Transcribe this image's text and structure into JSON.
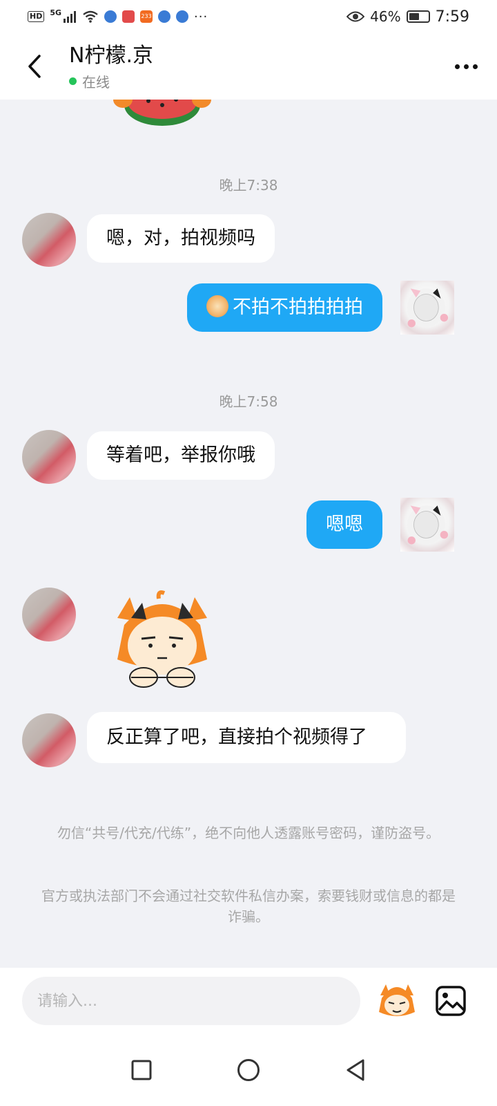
{
  "status_bar": {
    "hd": "HD",
    "network": "5G",
    "app_badge": "233",
    "overflow": "···",
    "battery": "46%",
    "time": "7:59"
  },
  "header": {
    "title": "N柠檬.京",
    "status": "在线"
  },
  "messages": [
    {
      "type": "timestamp",
      "text": "晚上7:38"
    },
    {
      "type": "incoming",
      "text": "嗯，对，拍视频吗"
    },
    {
      "type": "outgoing",
      "text": "不拍不拍拍拍拍"
    },
    {
      "type": "timestamp",
      "text": "晚上7:58"
    },
    {
      "type": "incoming",
      "text": "等着吧，举报你哦"
    },
    {
      "type": "outgoing",
      "text": "嗯嗯"
    },
    {
      "type": "incoming_sticker"
    },
    {
      "type": "incoming",
      "text": "反正算了吧，直接拍个视频得了"
    }
  ],
  "notices": [
    "勿信“共号/代充/代练”，绝不向他人透露账号密码，谨防盗号。",
    "官方或执法部门不会通过社交软件私信办案，索要钱财或信息的都是诈骗。"
  ],
  "input": {
    "placeholder": "请输入..."
  }
}
